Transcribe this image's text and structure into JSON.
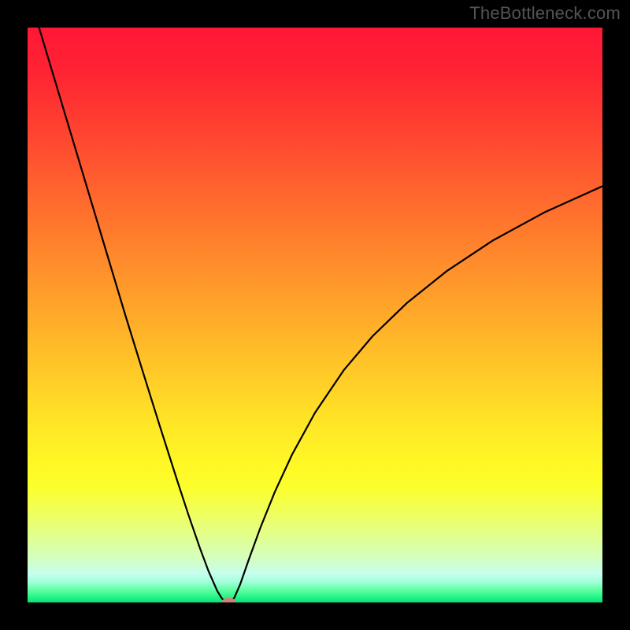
{
  "attribution": "TheBottleneck.com",
  "chart_data": {
    "type": "line",
    "title": "",
    "xlabel": "",
    "ylabel": "",
    "xlim": [
      0,
      100
    ],
    "ylim": [
      0,
      100
    ],
    "background_gradient": {
      "stops": [
        {
          "offset": 0.0,
          "color": "#ff1736"
        },
        {
          "offset": 0.08,
          "color": "#ff2433"
        },
        {
          "offset": 0.18,
          "color": "#ff4330"
        },
        {
          "offset": 0.28,
          "color": "#ff632e"
        },
        {
          "offset": 0.38,
          "color": "#ff832c"
        },
        {
          "offset": 0.48,
          "color": "#ffa32a"
        },
        {
          "offset": 0.58,
          "color": "#ffc328"
        },
        {
          "offset": 0.68,
          "color": "#ffe326"
        },
        {
          "offset": 0.76,
          "color": "#fff825"
        },
        {
          "offset": 0.8,
          "color": "#fcff2d"
        },
        {
          "offset": 0.84,
          "color": "#f0ff58"
        },
        {
          "offset": 0.88,
          "color": "#e3ff88"
        },
        {
          "offset": 0.92,
          "color": "#d5ffbb"
        },
        {
          "offset": 0.95,
          "color": "#c6ffee"
        },
        {
          "offset": 0.965,
          "color": "#a0ffd8"
        },
        {
          "offset": 0.98,
          "color": "#56ff9e"
        },
        {
          "offset": 1.0,
          "color": "#00e676"
        }
      ]
    },
    "curve": {
      "x": [
        2,
        5,
        8,
        11,
        14,
        17,
        20,
        23,
        26,
        28,
        30,
        31.5,
        33,
        33.8,
        34.3,
        34.6,
        34.8,
        35,
        35.2,
        35.5,
        36,
        37,
        38.5,
        40.5,
        43,
        46,
        50,
        55,
        60,
        66,
        73,
        81,
        90,
        100
      ],
      "y": [
        100,
        90.0,
        80.0,
        70.0,
        60.0,
        50.0,
        40.3,
        30.7,
        21.3,
        15.2,
        9.4,
        5.4,
        2.0,
        0.7,
        0.2,
        0.07,
        0.02,
        0.0,
        0.04,
        0.2,
        0.9,
        3.2,
        7.5,
        13.0,
        19.2,
        25.7,
        33.0,
        40.4,
        46.3,
        52.1,
        57.7,
        63.0,
        67.9,
        72.4
      ]
    },
    "marker": {
      "x": 35,
      "y": 0,
      "color": "#d08078",
      "rx": 9,
      "ry": 6
    }
  }
}
